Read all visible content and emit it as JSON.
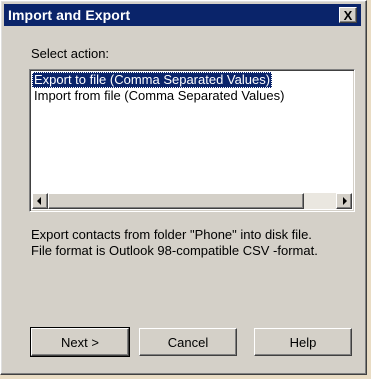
{
  "window": {
    "title": "Import and Export",
    "close_label": "X"
  },
  "main": {
    "select_label": "Select action:",
    "actions": [
      {
        "label": "Export to file (Comma Separated Values)",
        "selected": true
      },
      {
        "label": "Import from file (Comma Separated Values)",
        "selected": false
      }
    ],
    "description_lines": [
      "Export contacts from folder \"Phone\" into disk file.",
      "File format is Outlook 98-compatible CSV -format."
    ]
  },
  "buttons": {
    "next": "Next >",
    "cancel": "Cancel",
    "help": "Help"
  },
  "icons": {
    "scroll_left": "left-arrow-icon",
    "scroll_right": "right-arrow-icon"
  },
  "colors": {
    "titlebar": "#0a246a",
    "window_bg": "#d4d0c8",
    "selection": "#0a246a"
  }
}
